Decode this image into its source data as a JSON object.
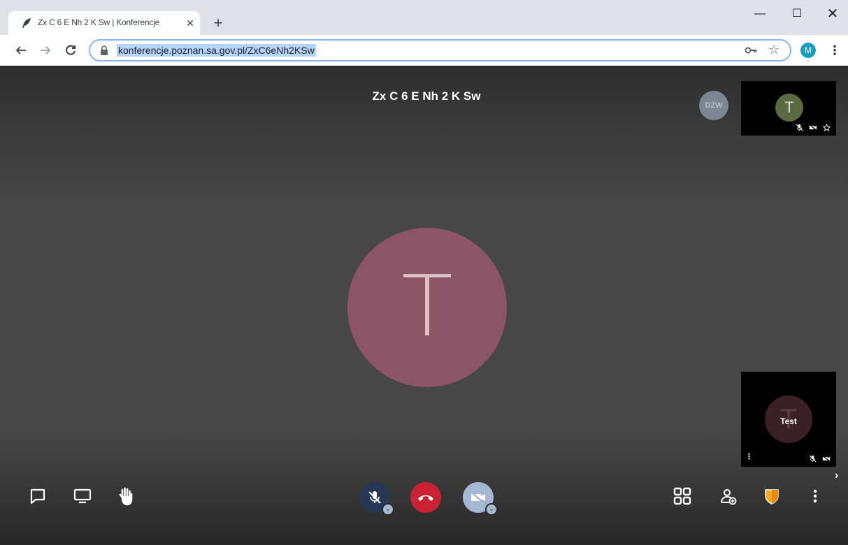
{
  "browser": {
    "tab_title": "Zx C 6 E Nh 2 K Sw | Konferencje",
    "tab_close": "✕",
    "new_tab": "+",
    "url": "konferencje.poznan.sa.gov.pl/ZxC6eNh2KSw",
    "profile_initial": "M",
    "window_controls": {
      "minimize": "—",
      "maximize": "☐",
      "close": "✕"
    }
  },
  "meeting": {
    "title": "Zx C 6 E Nh 2 K Sw",
    "main_avatar_initial": "T",
    "dominant_speaker_badge": "DŻW"
  },
  "thumbnails": [
    {
      "avatar_initial": "T",
      "name": "",
      "status_icons": [
        "mic-muted-icon",
        "camera-off-icon",
        "star-icon"
      ]
    },
    {
      "avatar_initial": "T",
      "name": "Test",
      "status_icons": [
        "mic-muted-icon",
        "camera-off-icon"
      ]
    }
  ],
  "toolbar": {
    "left": [
      "chat-icon",
      "screen-share-icon",
      "raise-hand-icon"
    ],
    "center": [
      "mic-muted-icon",
      "hangup-icon",
      "camera-off-icon"
    ],
    "right": [
      "tile-view-icon",
      "invite-icon",
      "security-shield-icon",
      "more-icon"
    ]
  },
  "colors": {
    "main_avatar": "#8c5567",
    "hangup": "#cb2233",
    "mic_button": "#263854",
    "cam_button": "#a4b8d1",
    "shield": "#f5a623",
    "profile": "#1a9ebd"
  }
}
